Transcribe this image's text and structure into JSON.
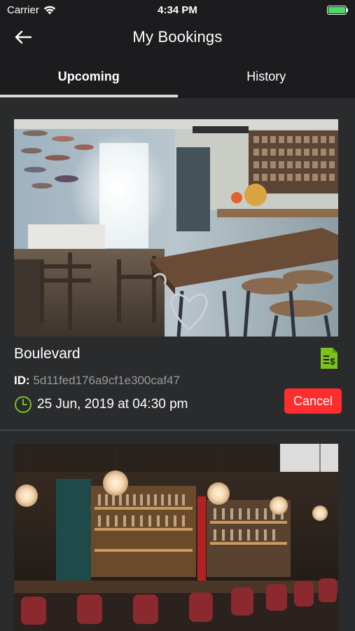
{
  "status_bar": {
    "carrier": "Carrier",
    "time": "4:34 PM"
  },
  "nav": {
    "title": "My Bookings"
  },
  "tabs": [
    {
      "label": "Upcoming",
      "active": true
    },
    {
      "label": "History",
      "active": false
    }
  ],
  "bookings": [
    {
      "venue": "Boulevard",
      "id_label": "ID:",
      "id_value": "5d11fed176a9cf1e300caf47",
      "datetime": "25 Jun, 2019 at 04:30 pm",
      "cancel_label": "Cancel"
    }
  ],
  "colors": {
    "accent_green": "#7bc21e",
    "cancel_red": "#ff2d2d",
    "background": "#2a2b2d",
    "bar": "#1c1c1e"
  }
}
